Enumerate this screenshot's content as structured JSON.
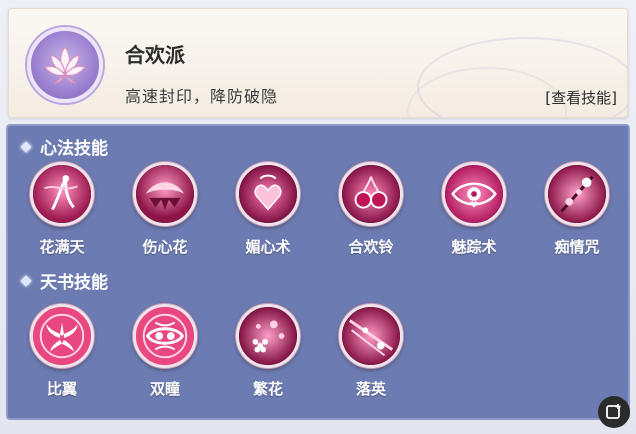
{
  "header": {
    "sect_name": "合欢派",
    "sect_desc": "高速封印，降防破隐",
    "view_skills_label": "[查看技能]",
    "emblem_icon": "lotus-icon"
  },
  "sections": {
    "xinfa": {
      "title": "心法技能",
      "skills": [
        {
          "name": "花满天",
          "icon": "dancer-petals-icon"
        },
        {
          "name": "伤心花",
          "icon": "wilting-flower-icon"
        },
        {
          "name": "媚心术",
          "icon": "charm-heart-icon"
        },
        {
          "name": "合欢铃",
          "icon": "cherry-bells-icon"
        },
        {
          "name": "魅踪术",
          "icon": "eye-icon"
        },
        {
          "name": "痴情咒",
          "icon": "branch-blossom-icon"
        }
      ]
    },
    "tianshu": {
      "title": "天书技能",
      "skills": [
        {
          "name": "比翼",
          "icon": "wings-icon"
        },
        {
          "name": "双瞳",
          "icon": "twin-eyes-icon"
        },
        {
          "name": "繁花",
          "icon": "blossoms-icon"
        },
        {
          "name": "落英",
          "icon": "falling-petals-icon"
        }
      ]
    }
  },
  "colors": {
    "panel_bg": "#6c7bb1",
    "skill_pink": "#e8477f",
    "emblem_purple": "#9b80cf"
  },
  "corner_button": {
    "icon": "add-note-icon"
  }
}
